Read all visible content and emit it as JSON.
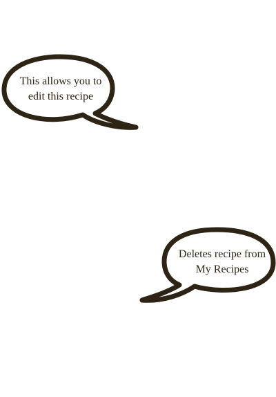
{
  "callouts": {
    "edit": {
      "text": "This allows you to\nedit this recipe"
    },
    "delete": {
      "text": "Deletes recipe from\nMy Recipes"
    }
  },
  "colors": {
    "bubble_stroke": "#2e2416",
    "bubble_fill": "#ffffff",
    "text": "#2e2416"
  }
}
